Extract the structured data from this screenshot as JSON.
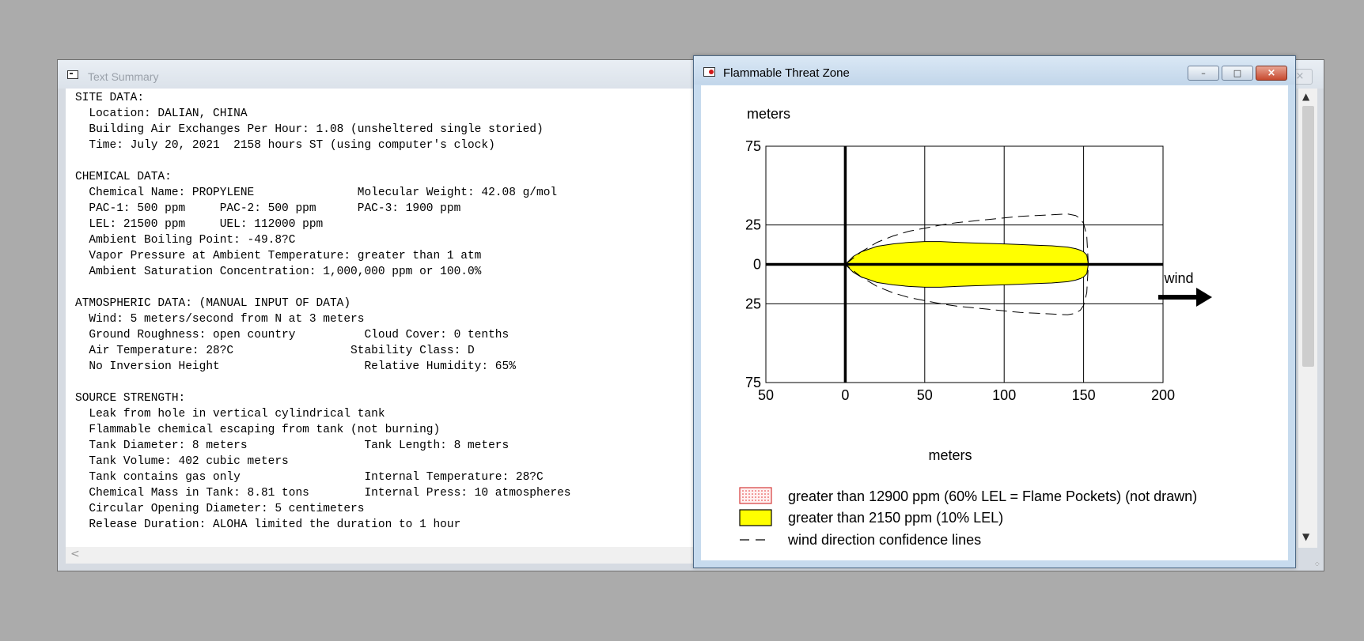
{
  "text_summary": {
    "title": "Text Summary",
    "close_icon": "×",
    "scroll_left_icon": "<",
    "scroll_up_icon": "▲",
    "scroll_down_icon": "▼",
    "lines": [
      "SITE DATA:",
      "  Location: DALIAN, CHINA",
      "  Building Air Exchanges Per Hour: 1.08 (unsheltered single storied)",
      "  Time: July 20, 2021  2158 hours ST (using computer's clock)",
      "",
      "CHEMICAL DATA:",
      "  Chemical Name: PROPYLENE               Molecular Weight: 42.08 g/mol",
      "  PAC-1: 500 ppm     PAC-2: 500 ppm      PAC-3: 1900 ppm",
      "  LEL: 21500 ppm     UEL: 112000 ppm",
      "  Ambient Boiling Point: -49.8?C",
      "  Vapor Pressure at Ambient Temperature: greater than 1 atm",
      "  Ambient Saturation Concentration: 1,000,000 ppm or 100.0%",
      "",
      "ATMOSPHERIC DATA: (MANUAL INPUT OF DATA)",
      "  Wind: 5 meters/second from N at 3 meters",
      "  Ground Roughness: open country          Cloud Cover: 0 tenths",
      "  Air Temperature: 28?C                 Stability Class: D",
      "  No Inversion Height                     Relative Humidity: 65%",
      "",
      "SOURCE STRENGTH:",
      "  Leak from hole in vertical cylindrical tank",
      "  Flammable chemical escaping from tank (not burning)",
      "  Tank Diameter: 8 meters                 Tank Length: 8 meters",
      "  Tank Volume: 402 cubic meters",
      "  Tank contains gas only                  Internal Temperature: 28?C",
      "  Chemical Mass in Tank: 8.81 tons        Internal Press: 10 atmospheres",
      "  Circular Opening Diameter: 5 centimeters",
      "  Release Duration: ALOHA limited the duration to 1 hour"
    ]
  },
  "threat_zone": {
    "title": "Flammable Threat Zone",
    "minimize_icon": "–",
    "maximize_icon": "□",
    "close_icon": "×",
    "wind_label": "wind",
    "legend": [
      {
        "label": "greater than 12900 ppm (60% LEL = Flame Pockets) (not drawn)",
        "swatch": "dotted-red"
      },
      {
        "label": "greater than 2150 ppm (10% LEL)",
        "swatch": "yellow"
      },
      {
        "label": "wind direction confidence lines",
        "swatch": "dashed-line"
      }
    ]
  },
  "chart_data": {
    "type": "area",
    "xlabel": "meters",
    "ylabel": "meters",
    "xlim": [
      -50,
      200
    ],
    "ylim": [
      -75,
      75
    ],
    "x_ticks": [
      "50",
      "0",
      "50",
      "100",
      "150",
      "200"
    ],
    "y_ticks": [
      "75",
      "25",
      "0",
      "25",
      "75"
    ],
    "x_tick_values": [
      -50,
      0,
      50,
      100,
      150,
      200
    ],
    "y_tick_values": [
      75,
      25,
      0,
      -25,
      -75
    ],
    "grid": true,
    "colors": {
      "zone_fill": "#ffff00",
      "zone_stroke": "#000000",
      "flame_pocket": "#e23030"
    },
    "series": [
      {
        "name": "greater than 2150 ppm (10% LEL)",
        "x": [
          0,
          5,
          10,
          20,
          30,
          40,
          50,
          60,
          70,
          80,
          90,
          100,
          110,
          120,
          130,
          140,
          145,
          148,
          150,
          152,
          153
        ],
        "y": [
          0,
          5,
          8,
          11.5,
          13,
          14,
          14.5,
          14.5,
          14,
          13.6,
          13.3,
          13,
          12.6,
          12.2,
          11.8,
          11,
          10,
          9,
          8,
          6,
          0
        ]
      },
      {
        "name": "wind direction confidence lines",
        "x": [
          0,
          10,
          20,
          30,
          40,
          50,
          60,
          70,
          80,
          90,
          100,
          110,
          120,
          130,
          140,
          145,
          148,
          150,
          152,
          153
        ],
        "y": [
          0,
          8,
          14,
          18,
          21,
          23,
          25,
          26.5,
          27.5,
          28.5,
          29.5,
          30.5,
          31,
          31.5,
          32,
          31,
          29,
          26,
          18,
          0
        ]
      }
    ]
  }
}
